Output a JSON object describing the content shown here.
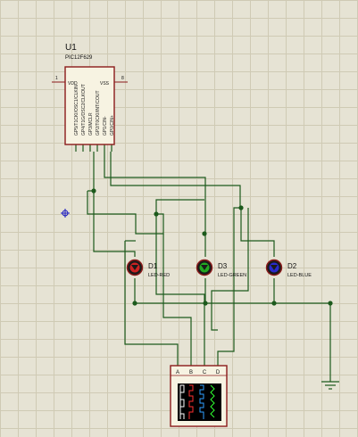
{
  "microcontroller": {
    "ref": "U1",
    "part": "PIC12F629",
    "left_pin_number": "1",
    "right_pin_number": "8",
    "vdd_label": "VDD",
    "vss_label": "VSS",
    "gpio_pins": [
      "GP5/T1CKI/OSC1/CLKIN",
      "GP4/T1G/OSC2/CLKOUT",
      "GP3/MCLR",
      "GP2/T0CKI/INT/COUT",
      "GP1/CIN-",
      "GP0/CIN+"
    ]
  },
  "leds": [
    {
      "ref": "D1",
      "value": "LED-RED",
      "color": "#cc2222"
    },
    {
      "ref": "D3",
      "value": "LED-GREEN",
      "color": "#22aa22"
    },
    {
      "ref": "D2",
      "value": "LED-BLUE",
      "color": "#2a2acc"
    }
  ],
  "logic_analyzer": {
    "channels": [
      "A",
      "B",
      "C",
      "D"
    ],
    "trace_colors": [
      "#ffffff",
      "#ff3030",
      "#30a0ff",
      "#30ff30"
    ]
  },
  "colors": {
    "wire": "#1c5a1c",
    "component_outline": "#8b1a1a",
    "origin_marker": "#1a1ac0"
  }
}
